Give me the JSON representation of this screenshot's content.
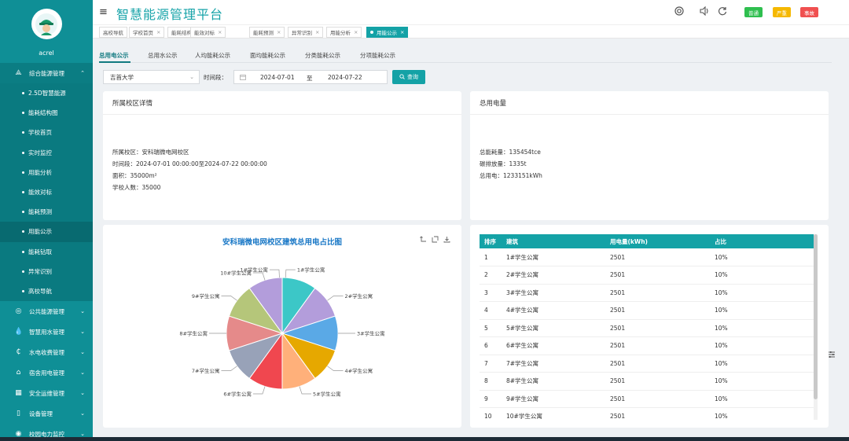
{
  "user": {
    "name": "acrel"
  },
  "header": {
    "title": "智慧能源管理平台",
    "badges": [
      {
        "label": "普通",
        "color": "#2fbf4f"
      },
      {
        "label": "严重",
        "color": "#f5b800"
      },
      {
        "label": "事故",
        "color": "#f05050"
      }
    ]
  },
  "sidebar": {
    "groups": [
      {
        "label": "综合能源管理",
        "icon": "grid-icon",
        "glyph": "⟁",
        "expanded": true
      },
      {
        "label": "公共能源管理",
        "icon": "coin-icon",
        "glyph": "◎"
      },
      {
        "label": "智慧用水管理",
        "icon": "water-drop-icon",
        "glyph": "💧"
      },
      {
        "label": "水电收费管理",
        "icon": "billing-icon",
        "glyph": "₵"
      },
      {
        "label": "宿舍用电管理",
        "icon": "home-icon",
        "glyph": "⌂"
      },
      {
        "label": "安全运维管理",
        "icon": "shield-icon",
        "glyph": "▦"
      },
      {
        "label": "设备管理",
        "icon": "device-icon",
        "glyph": "▯"
      },
      {
        "label": "校园电力监控",
        "icon": "monitor-icon",
        "glyph": "◉"
      }
    ],
    "sub_items": [
      "2.5D智慧能源",
      "能耗结构图",
      "学校首页",
      "实时监控",
      "用能分析",
      "能效对标",
      "能耗预测",
      "用能公示",
      "能耗钻取",
      "异常识别",
      "高校导航"
    ],
    "active_sub": "用能公示"
  },
  "tabs": [
    {
      "label": "高校导航",
      "closable": false
    },
    {
      "label": "学校首页",
      "closable": true
    },
    {
      "label": "能耗结构图",
      "closable": true
    },
    {
      "label": "能效对标",
      "closable": true
    },
    {
      "label": "能耗预测",
      "closable": true
    },
    {
      "label": "异常识别",
      "closable": true
    },
    {
      "label": "用能分析",
      "closable": true
    },
    {
      "label": "用能公示",
      "closable": true,
      "active": true
    }
  ],
  "subtabs": [
    "总用电公示",
    "总用水公示",
    "人均能耗公示",
    "面均能耗公示",
    "分类能耗公示",
    "分项能耗公示"
  ],
  "filters": {
    "campus": "吉首大学",
    "period_label": "时间段：",
    "date_start": "2024-07-01",
    "date_sep": "至",
    "date_end": "2024-07-22",
    "query": "查询"
  },
  "campus_card": {
    "title": "所属校区详情",
    "lines": [
      "所属校区：安科瑞微电网校区",
      "时间段：2024-07-01 00:00:00至2024-07-22 00:00:00",
      "面积：35000m²",
      "学校人数：35000"
    ]
  },
  "power_card": {
    "title": "总用电量",
    "lines": [
      "总能耗量：135454tce",
      "碳排放量：1335t",
      "总用电：1233151kWh"
    ]
  },
  "chart_data": {
    "type": "pie",
    "title": "安科瑞微电网校区建筑总用电占比图",
    "categories": [
      "1#学生公寓",
      "2#学生公寓",
      "3#学生公寓",
      "4#学生公寓",
      "5#学生公寓",
      "6#学生公寓",
      "7#学生公寓",
      "8#学生公寓",
      "9#学生公寓",
      "10#学生公寓"
    ],
    "values": [
      2501,
      2501,
      2501,
      2501,
      2501,
      2501,
      2501,
      2501,
      2501,
      2501
    ],
    "colors": [
      "#3cc7c7",
      "#b39ddb",
      "#5aa9e6",
      "#e6a800",
      "#ffb07a",
      "#f0474f",
      "#98a2b8",
      "#e58a8a",
      "#b5c67a",
      "#b39ddb"
    ],
    "label_names": [
      "1#学生公寓",
      "2#学生公寓",
      "3#学生公寓",
      "4#学生公寓",
      "5#学生公寓",
      "6#学生公寓",
      "7#学生公寓",
      "8#学生公寓",
      "9#学生公寓",
      "10#学生公寓",
      "1#学生公寓"
    ]
  },
  "table": {
    "headers": [
      "排序",
      "建筑",
      "用电量(kWh)",
      "占比"
    ],
    "rows": [
      [
        "1",
        "1#学生公寓",
        "2501",
        "10%"
      ],
      [
        "2",
        "2#学生公寓",
        "2501",
        "10%"
      ],
      [
        "3",
        "3#学生公寓",
        "2501",
        "10%"
      ],
      [
        "4",
        "4#学生公寓",
        "2501",
        "10%"
      ],
      [
        "5",
        "5#学生公寓",
        "2501",
        "10%"
      ],
      [
        "6",
        "6#学生公寓",
        "2501",
        "10%"
      ],
      [
        "7",
        "7#学生公寓",
        "2501",
        "10%"
      ],
      [
        "8",
        "8#学生公寓",
        "2501",
        "10%"
      ],
      [
        "9",
        "9#学生公寓",
        "2501",
        "10%"
      ],
      [
        "10",
        "10#学生公寓",
        "2501",
        "10%"
      ]
    ]
  }
}
